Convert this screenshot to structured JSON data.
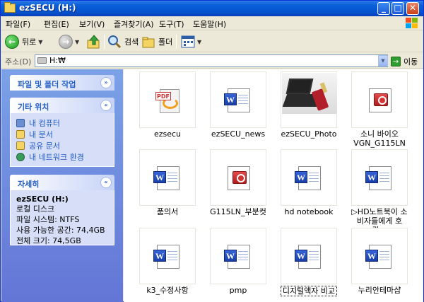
{
  "window": {
    "title": "ezSECU (H:)"
  },
  "menu": [
    "파일(F)",
    "편집(E)",
    "보기(V)",
    "즐겨찾기(A)",
    "도구(T)",
    "도움말(H)"
  ],
  "toolbar": {
    "back": "뒤로",
    "search": "검색",
    "folders": "폴더"
  },
  "address": {
    "label": "주소(D)",
    "value": "H:₩",
    "go": "이동"
  },
  "panels": {
    "file_tasks": {
      "title": "파일 및 폴더 작업"
    },
    "other_places": {
      "title": "기타 위치",
      "items": [
        "내 컴퓨터",
        "내 문서",
        "공유 문서",
        "내 네트워크 환경"
      ]
    },
    "details": {
      "title": "자세히",
      "name": "ezSECU (H:)",
      "type": "로컬 디스크",
      "fs": "파일 시스템: NTFS",
      "free": "사용 가능한 공간: 74,4GB",
      "total": "전체 크기: 74,5GB"
    }
  },
  "files": [
    {
      "name": "ezsecu",
      "kind": "pdf"
    },
    {
      "name": "ezSECU_news",
      "kind": "word"
    },
    {
      "name": "ezSECU_Photo",
      "kind": "photo"
    },
    {
      "name": "소니 바이오 VGN_G115LN",
      "kind": "ppt"
    },
    {
      "name": "품의서",
      "kind": "word"
    },
    {
      "name": "G115LN_부분컷",
      "kind": "ppt"
    },
    {
      "name": "hd notebook",
      "kind": "word"
    },
    {
      "name": "▷HD노트북이 소비자들에게 호감...",
      "kind": "word"
    },
    {
      "name": "k3_수정사항",
      "kind": "word"
    },
    {
      "name": "pmp",
      "kind": "word"
    },
    {
      "name": "디지털액자 비교",
      "kind": "word",
      "selected": true
    },
    {
      "name": "누리안테마샵",
      "kind": "word"
    }
  ],
  "colors": {
    "titlebar": "#0a5fd8",
    "taskpane": "#6d8de0",
    "link": "#215dc6"
  }
}
